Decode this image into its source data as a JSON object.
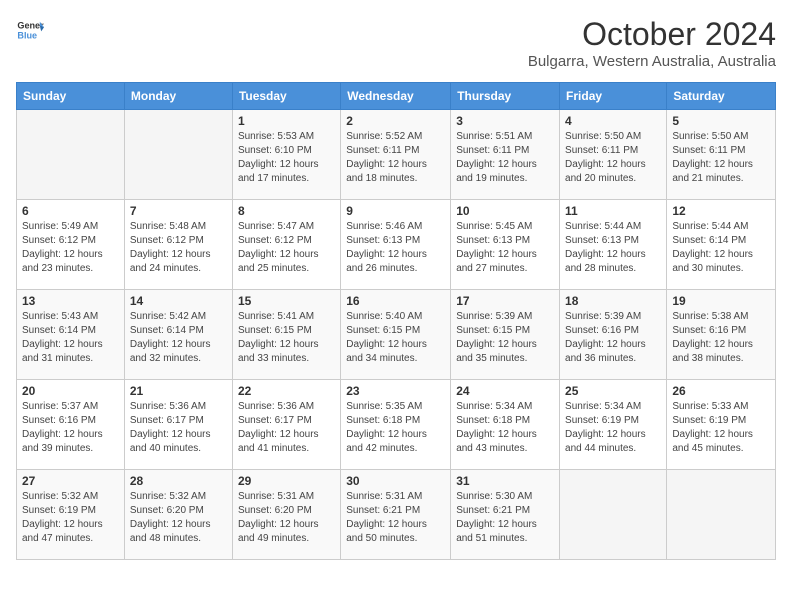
{
  "header": {
    "logo_general": "General",
    "logo_blue": "Blue",
    "title": "October 2024",
    "subtitle": "Bulgarra, Western Australia, Australia"
  },
  "days_of_week": [
    "Sunday",
    "Monday",
    "Tuesday",
    "Wednesday",
    "Thursday",
    "Friday",
    "Saturday"
  ],
  "weeks": [
    [
      {
        "day": "",
        "info": ""
      },
      {
        "day": "",
        "info": ""
      },
      {
        "day": "1",
        "info": "Sunrise: 5:53 AM\nSunset: 6:10 PM\nDaylight: 12 hours and 17 minutes."
      },
      {
        "day": "2",
        "info": "Sunrise: 5:52 AM\nSunset: 6:11 PM\nDaylight: 12 hours and 18 minutes."
      },
      {
        "day": "3",
        "info": "Sunrise: 5:51 AM\nSunset: 6:11 PM\nDaylight: 12 hours and 19 minutes."
      },
      {
        "day": "4",
        "info": "Sunrise: 5:50 AM\nSunset: 6:11 PM\nDaylight: 12 hours and 20 minutes."
      },
      {
        "day": "5",
        "info": "Sunrise: 5:50 AM\nSunset: 6:11 PM\nDaylight: 12 hours and 21 minutes."
      }
    ],
    [
      {
        "day": "6",
        "info": "Sunrise: 5:49 AM\nSunset: 6:12 PM\nDaylight: 12 hours and 23 minutes."
      },
      {
        "day": "7",
        "info": "Sunrise: 5:48 AM\nSunset: 6:12 PM\nDaylight: 12 hours and 24 minutes."
      },
      {
        "day": "8",
        "info": "Sunrise: 5:47 AM\nSunset: 6:12 PM\nDaylight: 12 hours and 25 minutes."
      },
      {
        "day": "9",
        "info": "Sunrise: 5:46 AM\nSunset: 6:13 PM\nDaylight: 12 hours and 26 minutes."
      },
      {
        "day": "10",
        "info": "Sunrise: 5:45 AM\nSunset: 6:13 PM\nDaylight: 12 hours and 27 minutes."
      },
      {
        "day": "11",
        "info": "Sunrise: 5:44 AM\nSunset: 6:13 PM\nDaylight: 12 hours and 28 minutes."
      },
      {
        "day": "12",
        "info": "Sunrise: 5:44 AM\nSunset: 6:14 PM\nDaylight: 12 hours and 30 minutes."
      }
    ],
    [
      {
        "day": "13",
        "info": "Sunrise: 5:43 AM\nSunset: 6:14 PM\nDaylight: 12 hours and 31 minutes."
      },
      {
        "day": "14",
        "info": "Sunrise: 5:42 AM\nSunset: 6:14 PM\nDaylight: 12 hours and 32 minutes."
      },
      {
        "day": "15",
        "info": "Sunrise: 5:41 AM\nSunset: 6:15 PM\nDaylight: 12 hours and 33 minutes."
      },
      {
        "day": "16",
        "info": "Sunrise: 5:40 AM\nSunset: 6:15 PM\nDaylight: 12 hours and 34 minutes."
      },
      {
        "day": "17",
        "info": "Sunrise: 5:39 AM\nSunset: 6:15 PM\nDaylight: 12 hours and 35 minutes."
      },
      {
        "day": "18",
        "info": "Sunrise: 5:39 AM\nSunset: 6:16 PM\nDaylight: 12 hours and 36 minutes."
      },
      {
        "day": "19",
        "info": "Sunrise: 5:38 AM\nSunset: 6:16 PM\nDaylight: 12 hours and 38 minutes."
      }
    ],
    [
      {
        "day": "20",
        "info": "Sunrise: 5:37 AM\nSunset: 6:16 PM\nDaylight: 12 hours and 39 minutes."
      },
      {
        "day": "21",
        "info": "Sunrise: 5:36 AM\nSunset: 6:17 PM\nDaylight: 12 hours and 40 minutes."
      },
      {
        "day": "22",
        "info": "Sunrise: 5:36 AM\nSunset: 6:17 PM\nDaylight: 12 hours and 41 minutes."
      },
      {
        "day": "23",
        "info": "Sunrise: 5:35 AM\nSunset: 6:18 PM\nDaylight: 12 hours and 42 minutes."
      },
      {
        "day": "24",
        "info": "Sunrise: 5:34 AM\nSunset: 6:18 PM\nDaylight: 12 hours and 43 minutes."
      },
      {
        "day": "25",
        "info": "Sunrise: 5:34 AM\nSunset: 6:19 PM\nDaylight: 12 hours and 44 minutes."
      },
      {
        "day": "26",
        "info": "Sunrise: 5:33 AM\nSunset: 6:19 PM\nDaylight: 12 hours and 45 minutes."
      }
    ],
    [
      {
        "day": "27",
        "info": "Sunrise: 5:32 AM\nSunset: 6:19 PM\nDaylight: 12 hours and 47 minutes."
      },
      {
        "day": "28",
        "info": "Sunrise: 5:32 AM\nSunset: 6:20 PM\nDaylight: 12 hours and 48 minutes."
      },
      {
        "day": "29",
        "info": "Sunrise: 5:31 AM\nSunset: 6:20 PM\nDaylight: 12 hours and 49 minutes."
      },
      {
        "day": "30",
        "info": "Sunrise: 5:31 AM\nSunset: 6:21 PM\nDaylight: 12 hours and 50 minutes."
      },
      {
        "day": "31",
        "info": "Sunrise: 5:30 AM\nSunset: 6:21 PM\nDaylight: 12 hours and 51 minutes."
      },
      {
        "day": "",
        "info": ""
      },
      {
        "day": "",
        "info": ""
      }
    ]
  ]
}
